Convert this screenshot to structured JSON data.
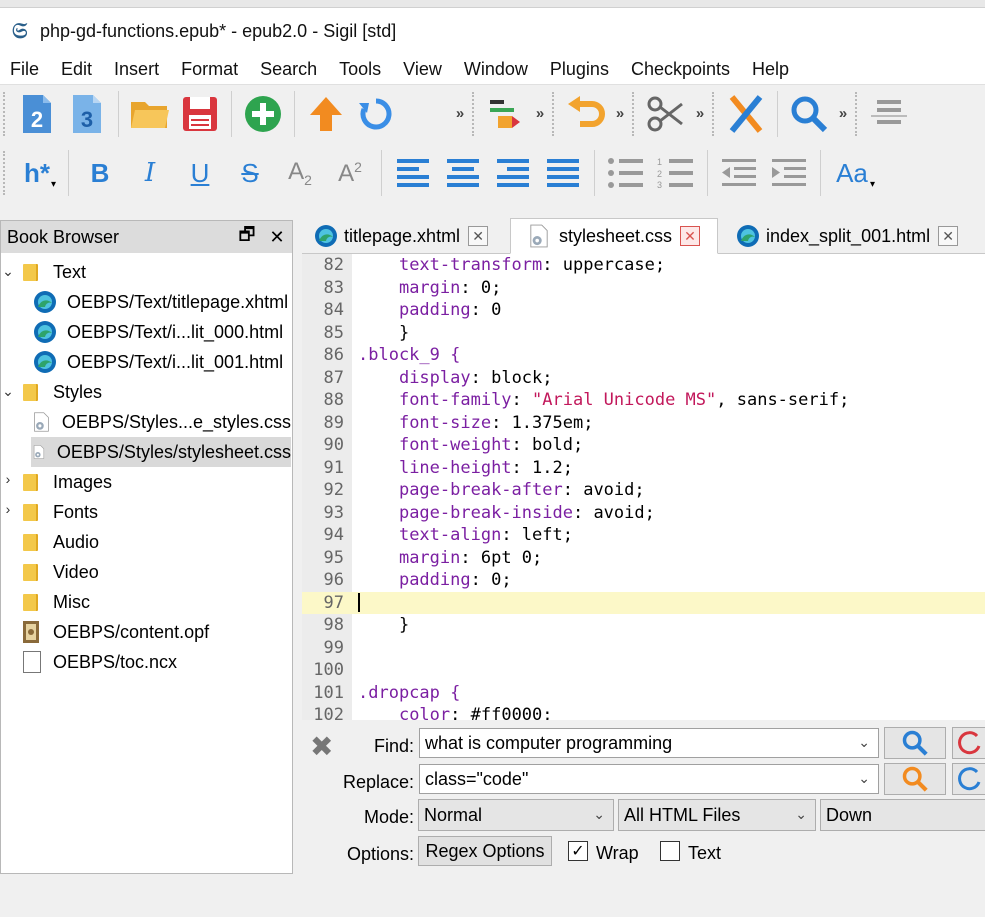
{
  "window": {
    "title": "php-gd-functions.epub* - epub2.0 - Sigil [std]"
  },
  "menu": [
    "File",
    "Edit",
    "Insert",
    "Format",
    "Search",
    "Tools",
    "View",
    "Window",
    "Plugins",
    "Checkpoints",
    "Help"
  ],
  "toolbar": {
    "heading_label": "h*",
    "case_label": "Aa",
    "chevron": "»"
  },
  "book_browser": {
    "title": "Book Browser",
    "float_glyph": "🗗",
    "close_glyph": "✕",
    "items": [
      {
        "label": "Text"
      },
      {
        "label": "OEBPS/Text/titlepage.xhtml"
      },
      {
        "label": "OEBPS/Text/i...lit_000.html"
      },
      {
        "label": "OEBPS/Text/i...lit_001.html"
      },
      {
        "label": "Styles"
      },
      {
        "label": "OEBPS/Styles...e_styles.css"
      },
      {
        "label": "OEBPS/Styles/stylesheet.css"
      },
      {
        "label": "Images"
      },
      {
        "label": "Fonts"
      },
      {
        "label": "Audio"
      },
      {
        "label": "Video"
      },
      {
        "label": "Misc"
      },
      {
        "label": "OEBPS/content.opf"
      },
      {
        "label": "OEBPS/toc.ncx"
      }
    ]
  },
  "tabs": [
    {
      "label": "titlepage.xhtml",
      "close": "✕"
    },
    {
      "label": "stylesheet.css",
      "close": "✕"
    },
    {
      "label": "index_split_001.html",
      "close": "✕"
    }
  ],
  "editor": {
    "lines": [
      {
        "n": "82",
        "prop": "text-transform",
        "val": "uppercase;"
      },
      {
        "n": "83",
        "prop": "margin",
        "val": "0;"
      },
      {
        "n": "84",
        "prop": "padding",
        "val": "0"
      },
      {
        "n": "85",
        "text": "    }"
      },
      {
        "n": "86",
        "text": ".block_9 {"
      },
      {
        "n": "87",
        "prop": "display",
        "val": "block;"
      },
      {
        "n": "88",
        "prop": "font-family",
        "str": "\"Arial Unicode MS\"",
        "val": ", sans-serif;"
      },
      {
        "n": "89",
        "prop": "font-size",
        "val": "1.375em;"
      },
      {
        "n": "90",
        "prop": "font-weight",
        "val": "bold;"
      },
      {
        "n": "91",
        "prop": "line-height",
        "val": "1.2;"
      },
      {
        "n": "92",
        "prop": "page-break-after",
        "val": "avoid;"
      },
      {
        "n": "93",
        "prop": "page-break-inside",
        "val": "avoid;"
      },
      {
        "n": "94",
        "prop": "text-align",
        "val": "left;"
      },
      {
        "n": "95",
        "prop": "margin",
        "val": "6pt 0;"
      },
      {
        "n": "96",
        "prop": "padding",
        "val": "0;"
      },
      {
        "n": "97",
        "text": ""
      },
      {
        "n": "98",
        "text": "    }"
      },
      {
        "n": "99",
        "text": ""
      },
      {
        "n": "100",
        "text": ""
      },
      {
        "n": "101",
        "text": ".dropcap {"
      },
      {
        "n": "102",
        "prop": "color",
        "val": "#ff0000;"
      }
    ]
  },
  "find": {
    "close_glyph": "✖",
    "find_label": "Find:",
    "find_value": "what is computer programming",
    "replace_label": "Replace:",
    "replace_value": "class=\"code\"",
    "mode_label": "Mode:",
    "mode_value": "Normal",
    "scope_value": "All HTML Files",
    "direction_value": "Down",
    "options_label": "Options:",
    "regex_options_label": "Regex Options",
    "wrap_label": "Wrap",
    "wrap_checked": "✓",
    "text_label": "Text",
    "dropdown_glyph": "⌄"
  }
}
